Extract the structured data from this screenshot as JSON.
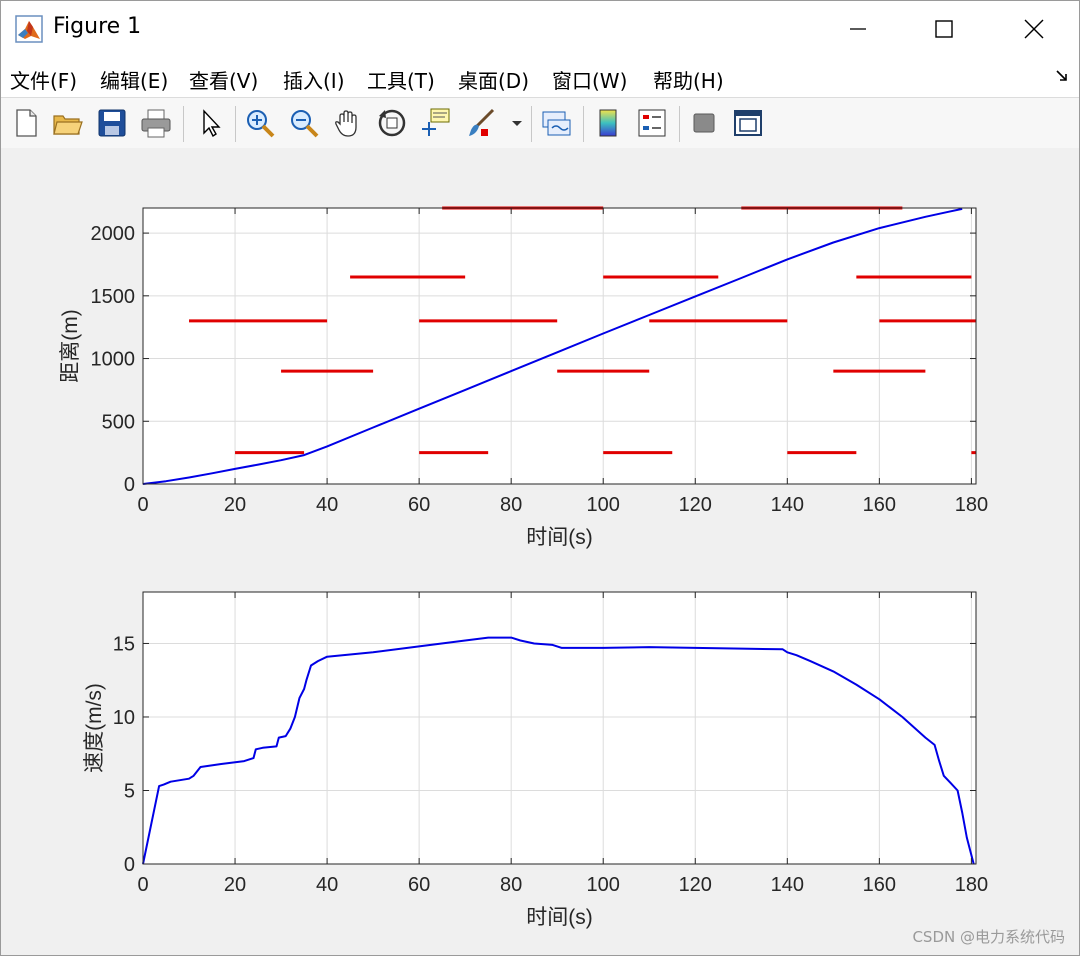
{
  "window": {
    "title": "Figure 1"
  },
  "menu": {
    "items": [
      "文件(F)",
      "编辑(E)",
      "查看(V)",
      "插入(I)",
      "工具(T)",
      "桌面(D)",
      "窗口(W)",
      "帮助(H)"
    ]
  },
  "toolbar": {
    "buttons": [
      {
        "icon": "new-figure-icon"
      },
      {
        "icon": "open-file-icon"
      },
      {
        "icon": "save-icon"
      },
      {
        "icon": "print-icon"
      },
      {
        "icon": "pointer-icon"
      },
      {
        "icon": "zoom-in-icon"
      },
      {
        "icon": "zoom-out-icon"
      },
      {
        "icon": "pan-icon"
      },
      {
        "icon": "rotate-3d-icon"
      },
      {
        "icon": "data-cursor-icon"
      },
      {
        "icon": "brush-icon"
      },
      {
        "icon": "link-plot-icon"
      },
      {
        "icon": "colorbar-icon"
      },
      {
        "icon": "legend-icon"
      },
      {
        "icon": "hide-plot-tools-icon"
      },
      {
        "icon": "show-plot-tools-icon"
      }
    ]
  },
  "watermark": "CSDN @电力系统代码",
  "chart_data": [
    {
      "type": "line",
      "xlabel": "时间(s)",
      "ylabel": "距离(m)",
      "xlim": [
        0,
        181
      ],
      "ylim": [
        0,
        2200
      ],
      "xticks": [
        0,
        20,
        40,
        60,
        80,
        100,
        120,
        140,
        160,
        180
      ],
      "yticks": [
        0,
        500,
        1000,
        1500,
        2000
      ],
      "grid": true,
      "series": [
        {
          "color": "#0000e6",
          "x": [
            0,
            5,
            10,
            15,
            20,
            25,
            30,
            35,
            40,
            50,
            60,
            70,
            80,
            90,
            100,
            110,
            120,
            130,
            140,
            150,
            160,
            170,
            175,
            178
          ],
          "y": [
            0,
            22,
            52,
            85,
            120,
            155,
            190,
            230,
            300,
            450,
            600,
            750,
            900,
            1050,
            1200,
            1347,
            1495,
            1642,
            1790,
            1925,
            2040,
            2130,
            2170,
            2193
          ]
        }
      ],
      "segments": {
        "color": "#e00000",
        "items": [
          {
            "x": [
              20,
              35
            ],
            "y": 250
          },
          {
            "x": [
              60,
              75
            ],
            "y": 250
          },
          {
            "x": [
              100,
              115
            ],
            "y": 250
          },
          {
            "x": [
              140,
              155
            ],
            "y": 250
          },
          {
            "x": [
              180,
              181
            ],
            "y": 250
          },
          {
            "x": [
              30,
              50
            ],
            "y": 900
          },
          {
            "x": [
              90,
              110
            ],
            "y": 900
          },
          {
            "x": [
              150,
              170
            ],
            "y": 900
          },
          {
            "x": [
              10,
              40
            ],
            "y": 1300
          },
          {
            "x": [
              60,
              90
            ],
            "y": 1300
          },
          {
            "x": [
              110,
              140
            ],
            "y": 1300
          },
          {
            "x": [
              160,
              181
            ],
            "y": 1300
          },
          {
            "x": [
              45,
              70
            ],
            "y": 1650
          },
          {
            "x": [
              100,
              125
            ],
            "y": 1650
          },
          {
            "x": [
              155,
              180
            ],
            "y": 1650
          },
          {
            "x": [
              65,
              100
            ],
            "y": 2200
          },
          {
            "x": [
              130,
              165
            ],
            "y": 2200
          }
        ]
      }
    },
    {
      "type": "line",
      "xlabel": "时间(s)",
      "ylabel": "速度(m/s)",
      "xlim": [
        0,
        181
      ],
      "ylim": [
        0,
        18.5
      ],
      "xticks": [
        0,
        20,
        40,
        60,
        80,
        100,
        120,
        140,
        160,
        180
      ],
      "yticks": [
        0,
        5,
        10,
        15
      ],
      "grid": true,
      "series": [
        {
          "color": "#0000e6",
          "x": [
            0,
            3.5,
            4.5,
            6,
            10,
            11,
            12.5,
            17,
            22,
            24,
            24.5,
            26,
            29,
            29.5,
            31,
            32,
            33,
            34,
            35,
            35.5,
            36.5,
            38,
            40,
            50,
            60,
            70,
            75,
            80,
            82,
            85,
            89,
            91,
            95,
            100,
            110,
            120,
            130,
            139,
            140,
            142,
            145,
            150,
            155,
            160,
            165,
            170,
            172,
            173,
            174,
            175.5,
            177,
            178,
            179,
            180.5
          ],
          "y": [
            0,
            5.3,
            5.4,
            5.6,
            5.8,
            6.0,
            6.6,
            6.8,
            7.0,
            7.2,
            7.8,
            7.9,
            8.0,
            8.6,
            8.7,
            9.2,
            10.0,
            11.3,
            11.9,
            12.5,
            13.5,
            13.8,
            14.1,
            14.4,
            14.8,
            15.2,
            15.4,
            15.4,
            15.2,
            15.0,
            14.9,
            14.7,
            14.7,
            14.7,
            14.75,
            14.7,
            14.65,
            14.6,
            14.4,
            14.2,
            13.8,
            13.1,
            12.2,
            11.2,
            10.0,
            8.6,
            8.1,
            7.0,
            6.0,
            5.5,
            5.0,
            3.5,
            1.8,
            0
          ]
        }
      ]
    }
  ]
}
